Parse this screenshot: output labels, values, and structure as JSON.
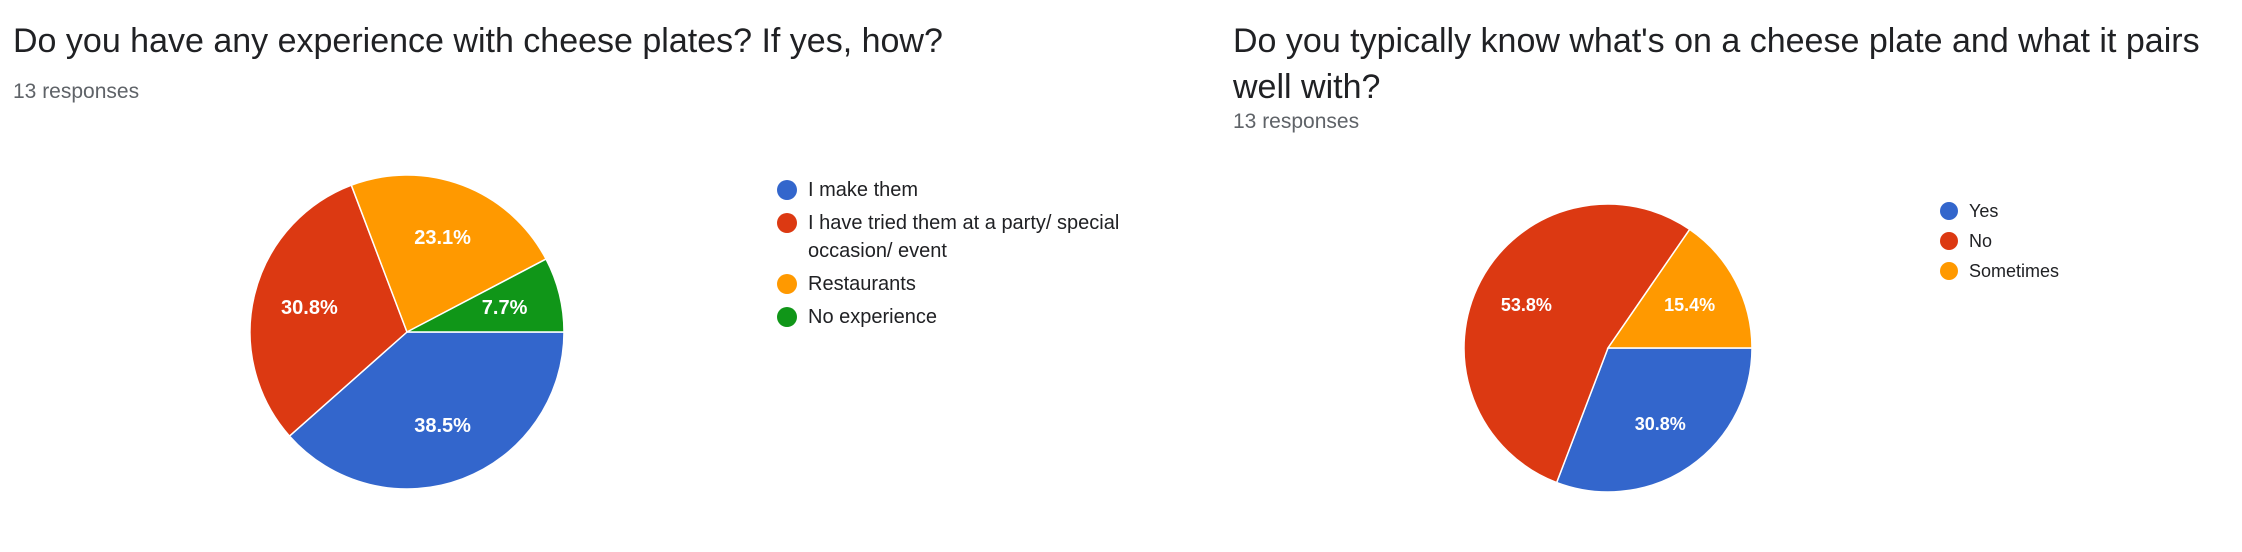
{
  "chart_data": [
    {
      "type": "pie",
      "title": "Do you have any experience with cheese plates? If yes, how?",
      "subtitle": "13 responses",
      "categories": [
        "I make them",
        "I have tried them at a party/ special occasion/ event",
        "Restaurants",
        "No experience"
      ],
      "values": [
        38.5,
        30.8,
        23.1,
        7.7
      ],
      "labels": [
        "38.5%",
        "30.8%",
        "23.1%",
        "7.7%"
      ],
      "colors": [
        "#3366cc",
        "#dc3912",
        "#ff9900",
        "#109618"
      ],
      "legend_position": "right"
    },
    {
      "type": "pie",
      "title": "Do you typically know what's on a cheese plate and what it pairs well with?",
      "subtitle": "13 responses",
      "categories": [
        "Yes",
        "No",
        "Sometimes"
      ],
      "values": [
        30.8,
        53.8,
        15.4
      ],
      "labels": [
        "30.8%",
        "53.8%",
        "15.4%"
      ],
      "colors": [
        "#3366cc",
        "#dc3912",
        "#ff9900"
      ],
      "legend_position": "right"
    }
  ]
}
